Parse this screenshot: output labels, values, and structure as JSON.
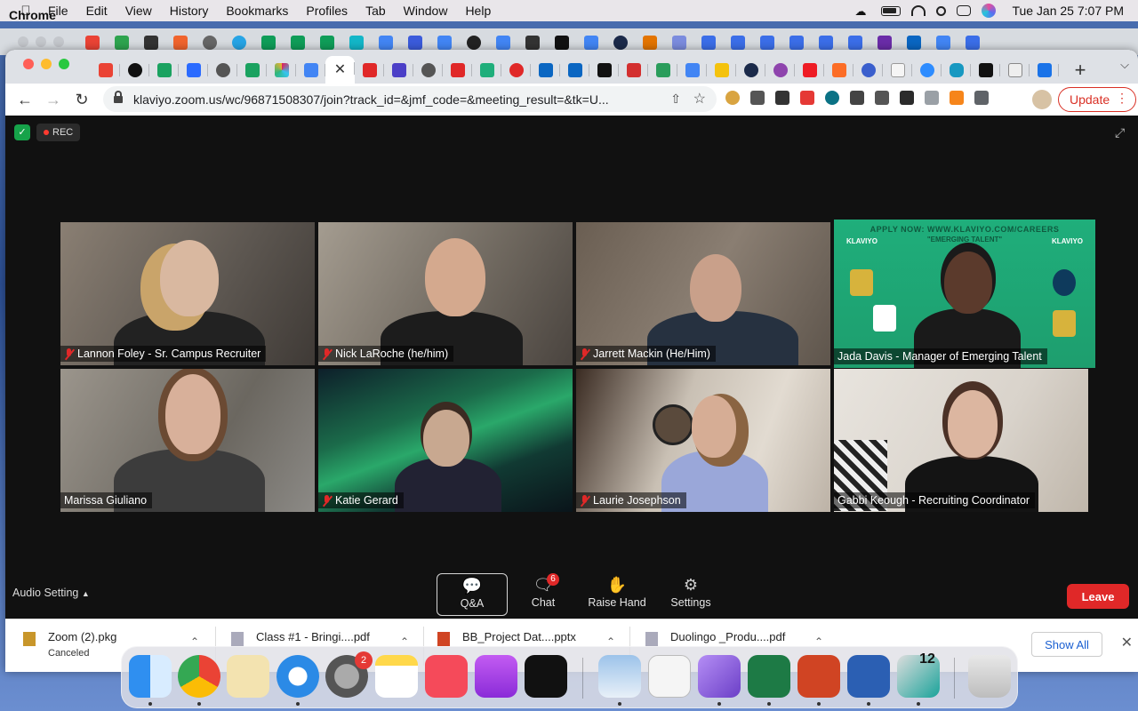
{
  "menubar": {
    "app_name": "Chrome",
    "items": [
      "File",
      "Edit",
      "View",
      "History",
      "Bookmarks",
      "Profiles",
      "Tab",
      "Window",
      "Help"
    ],
    "clock": "Tue Jan 25  7:07 PM"
  },
  "browser": {
    "url": "klaviyo.zoom.us/wc/96871508307/join?track_id=&jmf_code=&meeting_result=&tk=U...",
    "update_label": "Update",
    "active_tab_icon": "close-icon"
  },
  "zoom": {
    "rec_label": "REC",
    "participants": [
      {
        "name": "Lannon Foley - Sr. Campus Recruiter",
        "muted": true
      },
      {
        "name": "Nick LaRoche (he/him)",
        "muted": true
      },
      {
        "name": "Jarrett Mackin (He/Him)",
        "muted": true
      },
      {
        "name": "Jada Davis - Manager of Emerging Talent",
        "muted": false,
        "speaking": true
      },
      {
        "name": "Marissa Giuliano",
        "muted": false
      },
      {
        "name": "Katie Gerard",
        "muted": true
      },
      {
        "name": "Laurie Josephson",
        "muted": true
      },
      {
        "name": "Gabbi Keough - Recruiting Coordinator",
        "muted": false
      }
    ],
    "banner": {
      "apply": "APPLY NOW: WWW.KLAVIYO.COM/CAREERS",
      "tagline": "\"EMERGING TALENT\"",
      "logo": "KLAVIYO"
    },
    "controls": {
      "audio_setting": "Audio Setting",
      "qa": "Q&A",
      "chat": "Chat",
      "chat_badge": "6",
      "raise_hand": "Raise Hand",
      "settings": "Settings",
      "leave": "Leave"
    }
  },
  "downloads": {
    "items": [
      {
        "name": "Zoom (2).pkg",
        "status": "Canceled"
      },
      {
        "name": "Class #1 - Bringi....pdf",
        "status": ""
      },
      {
        "name": "BB_Project Dat....pptx",
        "status": ""
      },
      {
        "name": "Duolingo _Produ....pdf",
        "status": ""
      }
    ],
    "show_all": "Show All"
  },
  "dock": {
    "system_prefs_badge": "2",
    "calendar_day": "12"
  },
  "colors": {
    "leave_red": "#e02828",
    "speaking_outline": "#b8e04c",
    "klaviyo_green": "#1fae7b"
  }
}
